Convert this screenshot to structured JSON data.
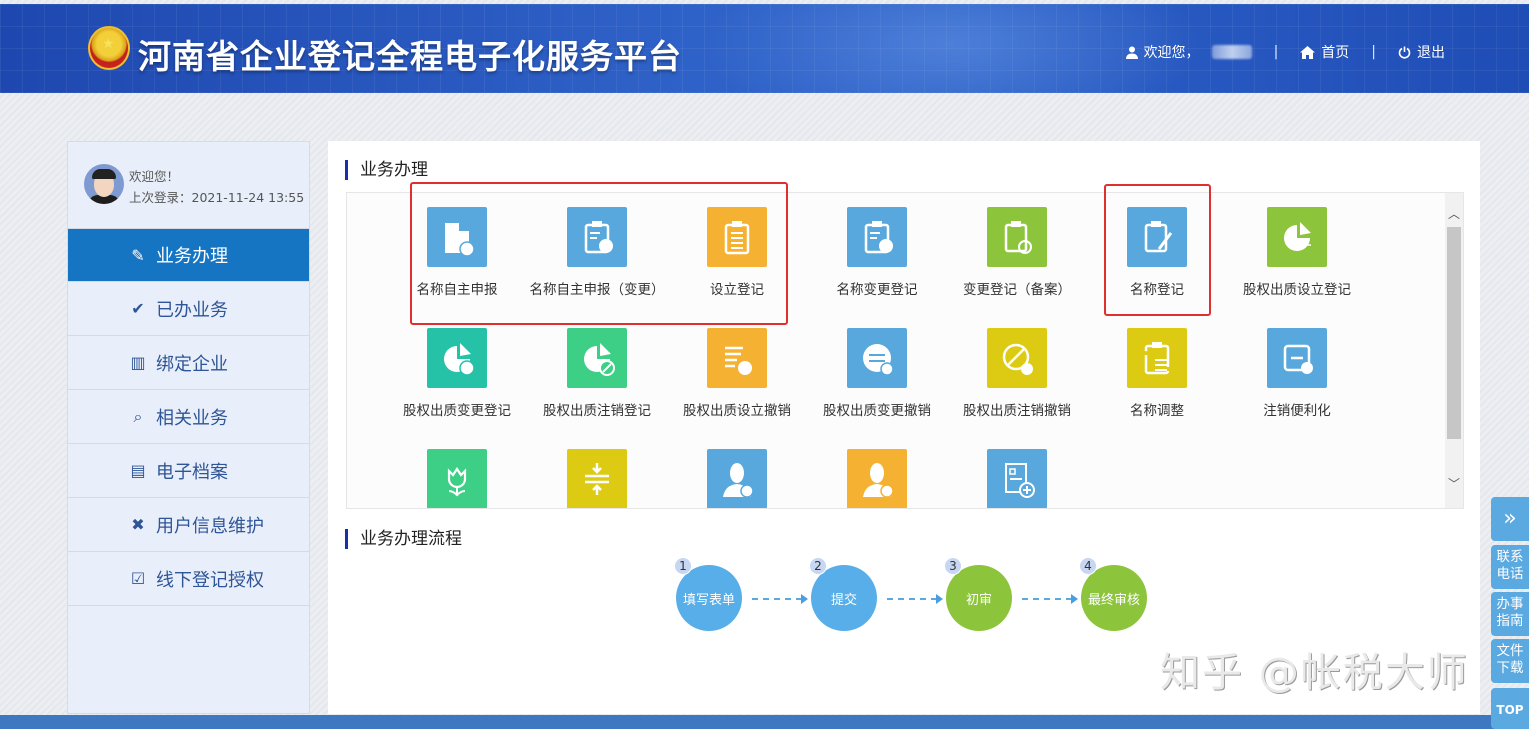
{
  "header": {
    "title": "河南省企业登记全程电子化服务平台",
    "welcome": "欢迎您，",
    "home": "首页",
    "logout": "退出",
    "sep": "|"
  },
  "sidebar": {
    "welcome": "欢迎您！",
    "last_login": "上次登录：2021-11-24 13:55",
    "items": [
      {
        "label": "业务办理",
        "icon": "clipboard-edit-icon",
        "active": true
      },
      {
        "label": "已办业务",
        "icon": "document-check-icon"
      },
      {
        "label": "绑定企业",
        "icon": "building-icon"
      },
      {
        "label": "相关业务",
        "icon": "document-search-icon"
      },
      {
        "label": "电子档案",
        "icon": "archive-box-icon"
      },
      {
        "label": "用户信息维护",
        "icon": "tools-icon"
      },
      {
        "label": "线下登记授权",
        "icon": "clipboard-check-icon"
      }
    ]
  },
  "main": {
    "services_title": "业务办理",
    "process_title": "业务办理流程",
    "services": [
      {
        "label": "名称自主申报",
        "color": "#58a8dd",
        "icon": "building-name-icon"
      },
      {
        "label": "名称自主申报（变更）",
        "color": "#58a8dd",
        "icon": "clipboard-exchange-icon"
      },
      {
        "label": "设立登记",
        "color": "#f5b131",
        "icon": "clipboard-list-icon"
      },
      {
        "label": "名称变更登记",
        "color": "#58a8dd",
        "icon": "clipboard-exchange-icon"
      },
      {
        "label": "变更登记（备案）",
        "color": "#8cc53b",
        "icon": "clipboard-refresh-icon"
      },
      {
        "label": "名称登记",
        "color": "#58a8dd",
        "icon": "clipboard-pen-icon"
      },
      {
        "label": "股权出质设立登记",
        "color": "#8cc53b",
        "icon": "pie-chart-doc-icon"
      },
      {
        "label": "股权出质变更登记",
        "color": "#26c2a8",
        "icon": "pie-chart-exchange-icon"
      },
      {
        "label": "股权出质注销登记",
        "color": "#3ccf85",
        "icon": "pie-chart-cancel-icon"
      },
      {
        "label": "股权出质设立撤销",
        "color": "#f5b131",
        "icon": "list-pen-undo-icon"
      },
      {
        "label": "股权出质变更撤销",
        "color": "#58a8dd",
        "icon": "exchange-undo-icon"
      },
      {
        "label": "股权出质注销撤销",
        "color": "#dccb12",
        "icon": "cancel-undo-icon"
      },
      {
        "label": "名称调整",
        "color": "#dccb12",
        "icon": "clipboard-sliders-icon"
      },
      {
        "label": "注销便利化",
        "color": "#58a8dd",
        "icon": "exit-flash-icon"
      },
      {
        "label": "",
        "color": "#3ccf85",
        "icon": "tulip-icon"
      },
      {
        "label": "",
        "color": "#dccb12",
        "icon": "merge-arrows-icon"
      },
      {
        "label": "",
        "color": "#58a8dd",
        "icon": "person-minus-icon"
      },
      {
        "label": "",
        "color": "#f5b131",
        "icon": "person-refresh-icon"
      },
      {
        "label": "",
        "color": "#58a8dd",
        "icon": "document-plus-icon"
      }
    ],
    "steps": [
      {
        "num": "1",
        "label": "填写表单",
        "color": "#58aee8"
      },
      {
        "num": "2",
        "label": "提交",
        "color": "#58aee8"
      },
      {
        "num": "3",
        "label": "初审",
        "color": "#8cc53b"
      },
      {
        "num": "4",
        "label": "最终审核",
        "color": "#8cc53b"
      }
    ]
  },
  "float_bar": {
    "expand": "»",
    "items": [
      "联系电话",
      "办事指南",
      "文件下载"
    ],
    "top": "TOP"
  },
  "watermark": "知乎 @帐税大师"
}
